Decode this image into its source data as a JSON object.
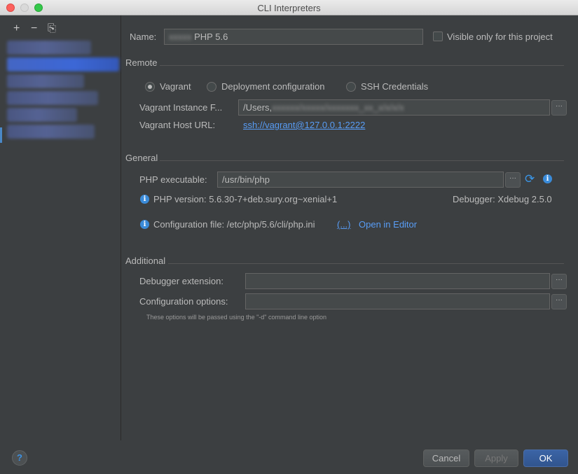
{
  "window": {
    "title": "CLI Interpreters"
  },
  "sidebar": {
    "add": "+",
    "remove": "−",
    "copy": "⎘"
  },
  "name_row": {
    "label": "Name:",
    "value_suffix": "PHP 5.6",
    "visible_only_label": "Visible only for this project"
  },
  "remote": {
    "title": "Remote",
    "options": [
      "Vagrant",
      "Deployment configuration",
      "SSH Credentials"
    ],
    "selected": "Vagrant",
    "instance_label": "Vagrant Instance F...",
    "instance_value_prefix": "/Users,",
    "host_url_label": "Vagrant Host URL:",
    "host_url_value": "ssh://vagrant@127.0.0.1:2222"
  },
  "general": {
    "title": "General",
    "php_exec_label": "PHP executable:",
    "php_exec_value": "/usr/bin/php",
    "php_version": "PHP version: 5.6.30-7+deb.sury.org~xenial+1",
    "debugger": "Debugger: Xdebug 2.5.0",
    "config_file": "Configuration file: /etc/php/5.6/cli/php.ini",
    "config_more": "(...)",
    "open_in_editor": "Open in Editor"
  },
  "additional": {
    "title": "Additional",
    "debugger_ext_label": "Debugger extension:",
    "config_options_label": "Configuration options:",
    "hint": "These options will be passed using the \"-d\" command line option"
  },
  "footer": {
    "help": "?",
    "cancel": "Cancel",
    "apply": "Apply",
    "ok": "OK"
  },
  "colors": {
    "accent": "#589df6",
    "background": "#3c3f41"
  }
}
